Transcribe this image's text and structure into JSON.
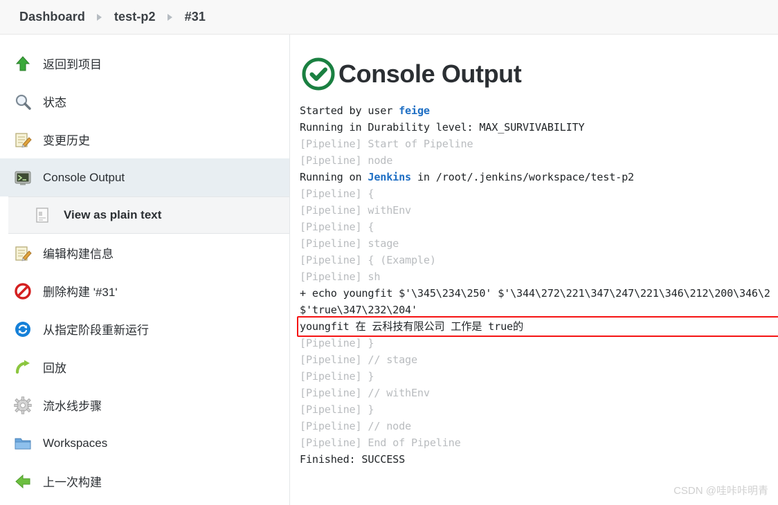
{
  "breadcrumb": {
    "items": [
      {
        "label": "Dashboard",
        "icon": ""
      },
      {
        "label": "test-p2",
        "icon": "chevron-right-icon"
      },
      {
        "label": "#31",
        "icon": "chevron-right-icon"
      }
    ]
  },
  "sidebar": {
    "items": [
      {
        "label": "返回到项目",
        "icon": "up-arrow-green-icon",
        "active": false
      },
      {
        "label": "状态",
        "icon": "magnifier-icon",
        "active": false
      },
      {
        "label": "变更历史",
        "icon": "notepad-pencil-icon",
        "active": false
      },
      {
        "label": "Console Output",
        "icon": "terminal-icon",
        "active": true
      }
    ],
    "sub_item": {
      "label": "View as plain text",
      "icon": "document-icon"
    },
    "items_after": [
      {
        "label": "编辑构建信息",
        "icon": "notepad-pencil-icon",
        "active": false
      },
      {
        "label": "删除构建 '#31'",
        "icon": "no-entry-icon",
        "active": false
      },
      {
        "label": "从指定阶段重新运行",
        "icon": "blue-refresh-icon",
        "active": false
      },
      {
        "label": "回放",
        "icon": "green-redo-arrow-icon",
        "active": false
      },
      {
        "label": "流水线步骤",
        "icon": "gear-icon",
        "active": false
      },
      {
        "label": "Workspaces",
        "icon": "folder-icon",
        "active": false
      },
      {
        "label": "上一次构建",
        "icon": "left-arrow-green-icon",
        "active": false
      }
    ]
  },
  "main": {
    "title": "Console Output",
    "status_icon": "success-check-circle-icon",
    "status_color": "#1a8041",
    "log": [
      {
        "type": "normal",
        "parts": [
          {
            "t": "Started by user ",
            "s": "plain"
          },
          {
            "t": "feige",
            "s": "link"
          }
        ]
      },
      {
        "type": "normal",
        "parts": [
          {
            "t": "Running in Durability level: MAX_SURVIVABILITY",
            "s": "plain"
          }
        ]
      },
      {
        "type": "pipeline",
        "parts": [
          {
            "t": "[Pipeline] Start of Pipeline",
            "s": "pipe"
          }
        ]
      },
      {
        "type": "pipeline",
        "parts": [
          {
            "t": "[Pipeline] node",
            "s": "pipe"
          }
        ]
      },
      {
        "type": "normal",
        "parts": [
          {
            "t": "Running on ",
            "s": "plain"
          },
          {
            "t": "Jenkins",
            "s": "link"
          },
          {
            "t": " in /root/.jenkins/workspace/test-p2",
            "s": "plain"
          }
        ]
      },
      {
        "type": "pipeline",
        "parts": [
          {
            "t": "[Pipeline] {",
            "s": "pipe"
          }
        ]
      },
      {
        "type": "pipeline",
        "parts": [
          {
            "t": "[Pipeline] withEnv",
            "s": "pipe"
          }
        ]
      },
      {
        "type": "pipeline",
        "parts": [
          {
            "t": "[Pipeline] {",
            "s": "pipe"
          }
        ]
      },
      {
        "type": "pipeline",
        "parts": [
          {
            "t": "[Pipeline] stage",
            "s": "pipe"
          }
        ]
      },
      {
        "type": "pipeline",
        "parts": [
          {
            "t": "[Pipeline] { (Example)",
            "s": "pipe"
          }
        ]
      },
      {
        "type": "pipeline",
        "parts": [
          {
            "t": "[Pipeline] sh",
            "s": "pipe"
          }
        ]
      },
      {
        "type": "normal",
        "parts": [
          {
            "t": "+ echo youngfit $'\\345\\234\\250' $'\\344\\272\\221\\347\\247\\221\\346\\212\\200\\346\\2",
            "s": "plain"
          }
        ]
      },
      {
        "type": "normal",
        "parts": [
          {
            "t": "$'true\\347\\232\\204'",
            "s": "plain"
          }
        ]
      },
      {
        "type": "highlight",
        "parts": [
          {
            "t": "youngfit 在 云科技有限公司 工作是 true的",
            "s": "plain"
          }
        ]
      },
      {
        "type": "pipeline",
        "parts": [
          {
            "t": "[Pipeline] }",
            "s": "pipe"
          }
        ]
      },
      {
        "type": "pipeline",
        "parts": [
          {
            "t": "[Pipeline] // stage",
            "s": "pipe"
          }
        ]
      },
      {
        "type": "pipeline",
        "parts": [
          {
            "t": "[Pipeline] }",
            "s": "pipe"
          }
        ]
      },
      {
        "type": "pipeline",
        "parts": [
          {
            "t": "[Pipeline] // withEnv",
            "s": "pipe"
          }
        ]
      },
      {
        "type": "pipeline",
        "parts": [
          {
            "t": "[Pipeline] }",
            "s": "pipe"
          }
        ]
      },
      {
        "type": "pipeline",
        "parts": [
          {
            "t": "[Pipeline] // node",
            "s": "pipe"
          }
        ]
      },
      {
        "type": "pipeline",
        "parts": [
          {
            "t": "[Pipeline] End of Pipeline",
            "s": "pipe"
          }
        ]
      },
      {
        "type": "normal",
        "parts": [
          {
            "t": "Finished: SUCCESS",
            "s": "plain"
          }
        ]
      }
    ],
    "highlight_color": "#f51313"
  },
  "watermark": {
    "text": "CSDN @哇咔咔明青"
  }
}
